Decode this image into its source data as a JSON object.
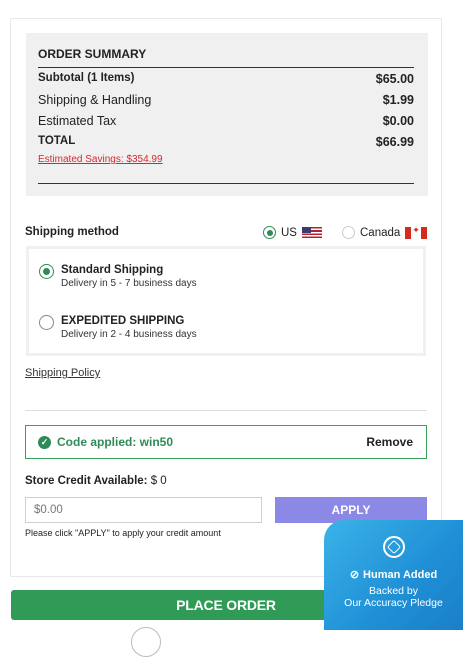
{
  "order_summary": {
    "title": "ORDER SUMMARY",
    "rows": [
      {
        "label": "Subtotal (1 Items)",
        "value": "$65.00"
      },
      {
        "label": "Shipping & Handling",
        "value": "$1.99"
      },
      {
        "label": "Estimated Tax",
        "value": "$0.00"
      },
      {
        "label": "TOTAL",
        "value": "$66.99"
      }
    ],
    "savings_label": "Estimated Savings:",
    "savings_value": "$354.99"
  },
  "shipping": {
    "label": "Shipping method",
    "countries": [
      {
        "label": "US",
        "selected": true,
        "flag": "us-flag-icon"
      },
      {
        "label": "Canada",
        "selected": false,
        "flag": "canada-flag-icon"
      }
    ],
    "methods": [
      {
        "title": "Standard Shipping",
        "detail": "Delivery in 5 - 7 business days",
        "selected": true
      },
      {
        "title": "EXPEDITED SHIPPING",
        "detail": "Delivery in 2 - 4 business days",
        "selected": false
      }
    ],
    "policy_link": "Shipping Policy"
  },
  "promo": {
    "applied_text": "Code applied: win50",
    "remove_label": "Remove"
  },
  "store_credit": {
    "label": "Store Credit Available:",
    "amount": "$ 0",
    "placeholder": "$0.00",
    "apply_label": "APPLY",
    "note": "Please click \"APPLY\" to apply your credit amount"
  },
  "place_order_label": "PLACE ORDER",
  "trust_badge": {
    "line1": "Human Added",
    "line2": "Backed by",
    "line3": "Our Accuracy Pledge"
  },
  "colors": {
    "accent_green": "#2f9b57",
    "apply_button": "#8c88e6",
    "savings_red": "#d9262b",
    "badge_blue": "#1f8fd6"
  }
}
